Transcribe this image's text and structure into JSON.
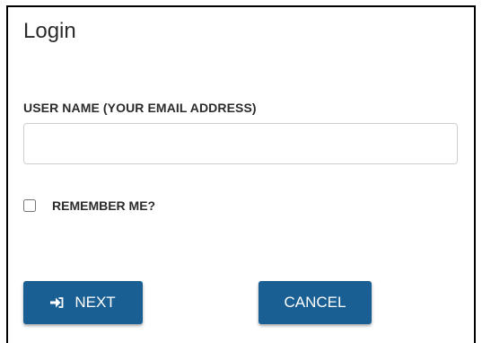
{
  "login": {
    "title": "Login",
    "username_label": "USER NAME (YOUR EMAIL ADDRESS)",
    "username_value": "",
    "remember_label": "REMEMBER ME?",
    "remember_checked": false,
    "next_label": "NEXT",
    "next_icon": "sign-in-icon",
    "cancel_label": "CANCEL"
  },
  "colors": {
    "button": "#1a5f93",
    "button_text": "#ffffff",
    "text": "#2b2b2b",
    "input_border": "#cfcfcf"
  }
}
